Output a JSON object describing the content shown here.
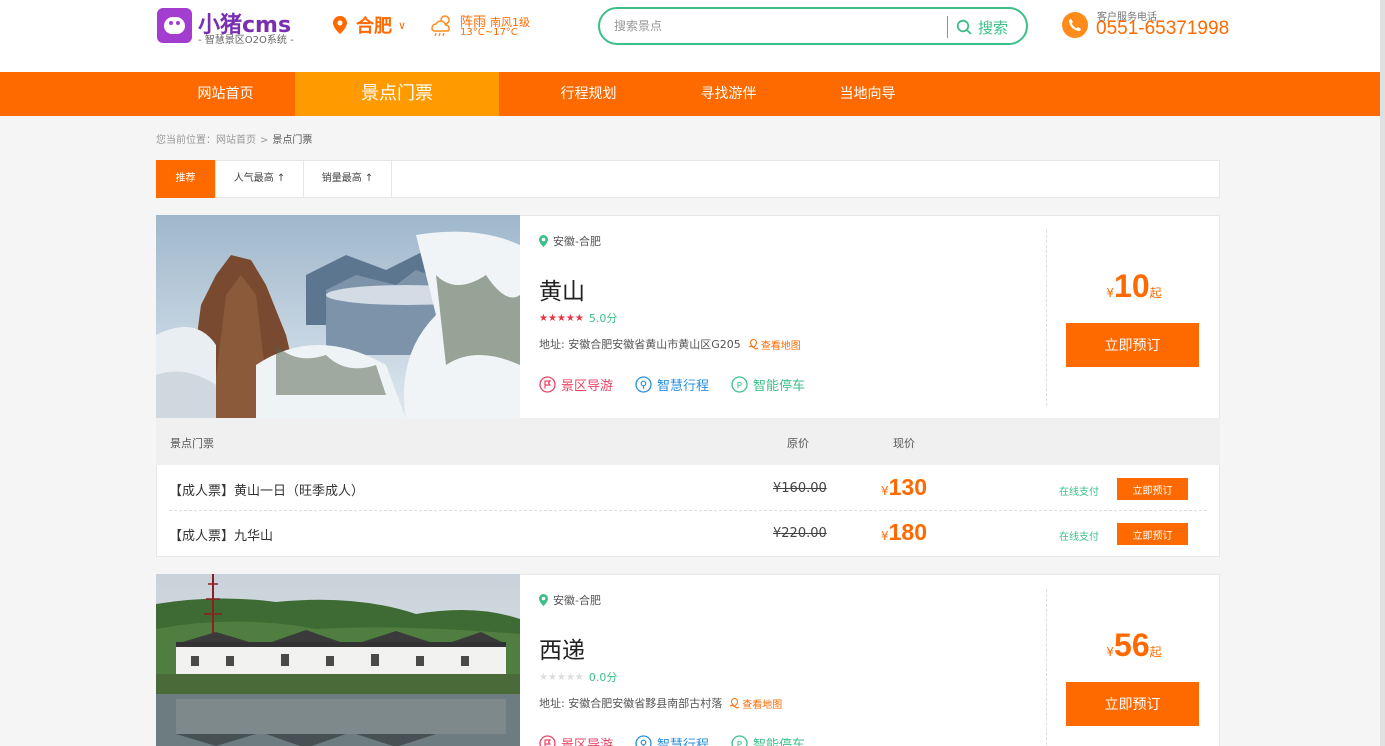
{
  "brand": {
    "name": "小猪cms",
    "tagline": "- 智慧景区O2O系统 -",
    "purple": "#a23dd0"
  },
  "city": {
    "name": "合肥"
  },
  "weather": {
    "condition": "阵雨",
    "wind": "南风1级",
    "temp": "13°C~17°C"
  },
  "search": {
    "placeholder": "搜索景点",
    "button": "搜索"
  },
  "hotline": {
    "label": "客户服务电话",
    "number": "0551-65371998"
  },
  "nav": [
    {
      "label": "网站首页"
    },
    {
      "label": "景点门票",
      "active": true
    },
    {
      "label": "行程规划"
    },
    {
      "label": "寻找游伴"
    },
    {
      "label": "当地向导"
    }
  ],
  "breadcrumb": {
    "prefix": "您当前位置：",
    "home": "网站首页",
    "sep": ">",
    "current": "景点门票"
  },
  "sort": [
    {
      "label": "推荐",
      "active": true
    },
    {
      "label": "人气最高 ↑"
    },
    {
      "label": "销量最高 ↑"
    }
  ],
  "common": {
    "map_link": "查看地图",
    "book": "立即预订",
    "price_suffix": "起",
    "currency": "¥",
    "features": [
      "景区导游",
      "智慧行程",
      "智能停车"
    ],
    "ticket_headers": {
      "name": "景点门票",
      "orig": "原价",
      "now": "现价"
    },
    "pay": "在线支付",
    "ticket_book": "立即预订"
  },
  "colors": {
    "accent": "#ff6a00",
    "nav_active": "#ff9a00",
    "green": "#3cc08a",
    "star": "#ee3344"
  },
  "spots": [
    {
      "location": "安徽-合肥",
      "name": "黄山",
      "stars": "★★★★★",
      "score": "5.0分",
      "address": "地址: 安徽合肥安徽省黄山市黄山区G205",
      "price": "10",
      "tickets": [
        {
          "name": "【成人票】黄山一日（旺季成人）",
          "orig": "¥160.00",
          "now": "130"
        },
        {
          "name": "【成人票】九华山",
          "orig": "¥220.00",
          "now": "180"
        }
      ]
    },
    {
      "location": "安徽-合肥",
      "name": "西递",
      "stars": "★★★★★",
      "score": "0.0分",
      "address": "地址: 安徽合肥安徽省黟县南部古村落",
      "price": "56",
      "tickets": []
    }
  ]
}
